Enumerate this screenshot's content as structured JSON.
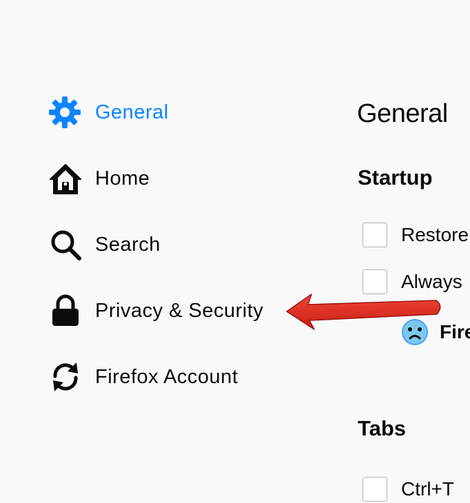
{
  "sidebar": {
    "items": [
      {
        "label": "General",
        "icon": "gear-icon",
        "selected": true
      },
      {
        "label": "Home",
        "icon": "home-icon",
        "selected": false
      },
      {
        "label": "Search",
        "icon": "search-icon",
        "selected": false
      },
      {
        "label": "Privacy & Security",
        "icon": "lock-icon",
        "selected": false
      },
      {
        "label": "Firefox Account",
        "icon": "sync-icon",
        "selected": false
      }
    ]
  },
  "main": {
    "title": "General",
    "startup": {
      "heading": "Startup",
      "options": [
        {
          "label": "Restore",
          "checked": false
        },
        {
          "label": "Always",
          "checked": false
        }
      ],
      "default_browser_text": "Fire"
    },
    "tabs": {
      "heading": "Tabs",
      "first_option_label": "Ctrl+T"
    }
  },
  "annotation": {
    "type": "arrow",
    "color": "#e0251c",
    "points_to": "sidebar-item-privacy-security"
  },
  "colors": {
    "accent": "#0a84ff",
    "background": "#f9f9fa",
    "text": "#0c0c0d"
  }
}
